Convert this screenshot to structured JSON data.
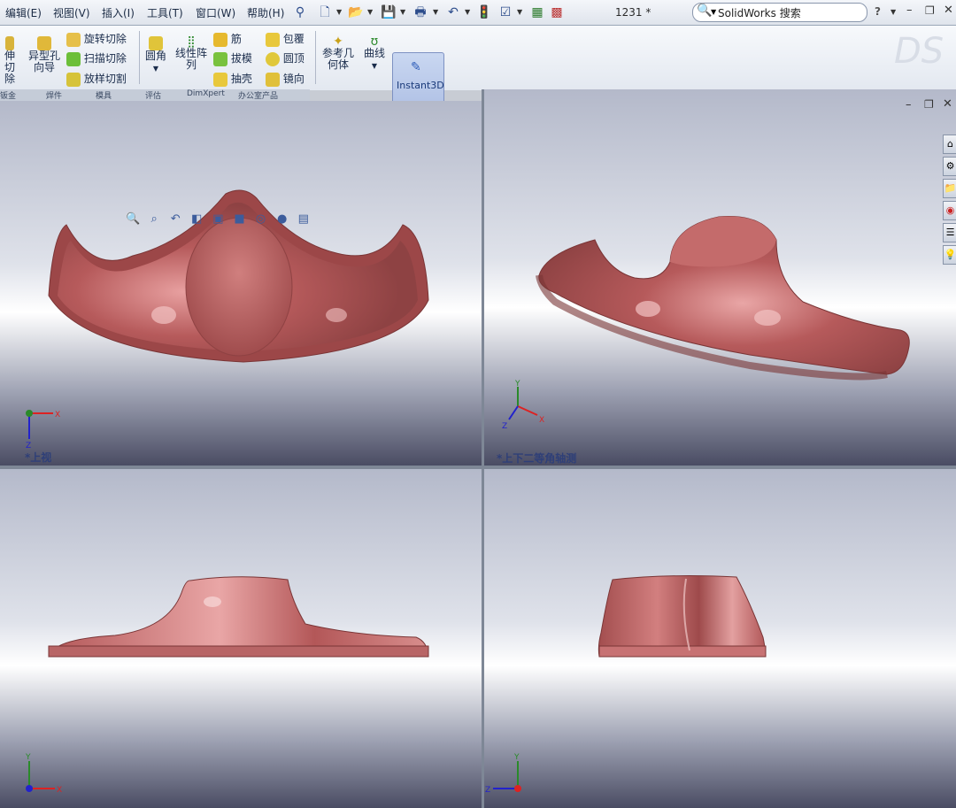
{
  "menubar": {
    "items": [
      "编辑(E)",
      "视图(V)",
      "插入(I)",
      "工具(T)",
      "窗口(W)",
      "帮助(H)"
    ],
    "document_title": "1231 *",
    "search_placeholder": "SolidWorks 搜索",
    "help_label": "?"
  },
  "ribbon": {
    "left_cut_label_1": "伸切",
    "left_cut_label_2": "除",
    "hole_wizard": [
      "异型孔",
      "向导"
    ],
    "revolve_cut": "旋转切除",
    "sweep_cut": "扫描切除",
    "loft_cut": "放样切割",
    "fillet": "圆角",
    "linear_pattern": [
      "线性阵",
      "列"
    ],
    "rib": "筋",
    "draft": "拔模",
    "shell": "抽壳",
    "wrap": "包覆",
    "dome": "圆顶",
    "mirror": "镜向",
    "ref_geometry": [
      "参考几",
      "何体"
    ],
    "curves": "曲线",
    "instant3d": "Instant3D"
  },
  "tabs": [
    "钣金",
    "焊件",
    "模具",
    "评估",
    "DimXpert",
    "办公室产品"
  ],
  "viewports": {
    "top_left": "*上视",
    "top_right": "*上下二等角轴测",
    "bottom_left": "",
    "bottom_right": ""
  },
  "triad_labels": {
    "x": "X",
    "y": "Y",
    "z": "Z"
  },
  "colors": {
    "part": "#b5595a",
    "part_highlight": "#e8a2a2",
    "part_shadow": "#7a3536",
    "accent": "#2e3f78"
  }
}
